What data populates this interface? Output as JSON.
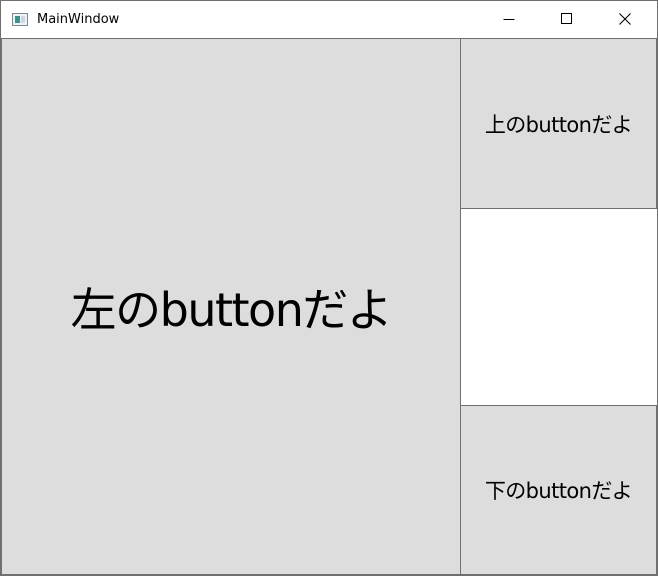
{
  "window": {
    "title": "MainWindow",
    "icon": "app-window-icon",
    "controls": {
      "minimize_icon": "minimize-icon",
      "maximize_icon": "maximize-icon",
      "close_icon": "close-icon"
    }
  },
  "buttons": {
    "left_label": "左のbuttonだよ",
    "top_label": "上のbuttonだよ",
    "bottom_label": "下のbuttonだよ"
  },
  "colors": {
    "button_face": "#dddddd",
    "button_border": "#707070",
    "window_background": "#ffffff"
  }
}
